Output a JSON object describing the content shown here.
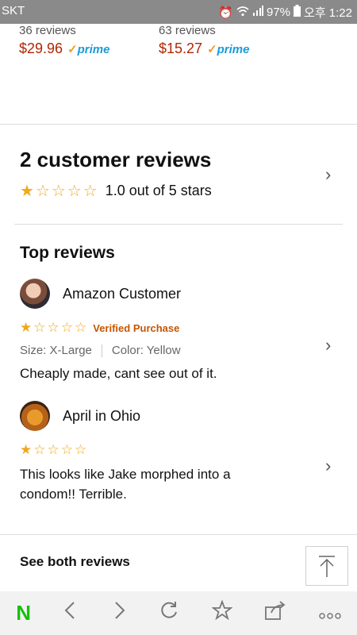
{
  "status_bar": {
    "carrier": "SKT",
    "battery": "97%",
    "time": "오후 1:22"
  },
  "products": [
    {
      "reviews": "36 reviews",
      "price": "$29.96",
      "prime": "prime"
    },
    {
      "reviews": "63 reviews",
      "price": "$15.27",
      "prime": "prime"
    }
  ],
  "customer_reviews": {
    "title": "2 customer reviews",
    "rating_text": "1.0 out of 5 stars",
    "rating": 1,
    "max_rating": 5
  },
  "top_reviews": {
    "title": "Top reviews",
    "items": [
      {
        "author": "Amazon Customer",
        "rating": 1,
        "badge": "Verified Purchase",
        "size": "Size: X-Large",
        "color": "Color: Yellow",
        "text": "Cheaply made, cant see out of it."
      },
      {
        "author": "April in Ohio",
        "rating": 1,
        "text": "This looks like Jake morphed into a condom!! Terrible."
      }
    ]
  },
  "see_all": "See both reviews",
  "colors": {
    "price": "#b12704",
    "star": "#f0a81c",
    "verified": "#c45500",
    "naver": "#18c10b"
  },
  "bottom_bar": {
    "icons": [
      "naver-icon",
      "back-icon",
      "forward-icon",
      "refresh-icon",
      "bookmark-star-icon",
      "share-icon",
      "more-icon"
    ],
    "naver_letter": "N"
  }
}
